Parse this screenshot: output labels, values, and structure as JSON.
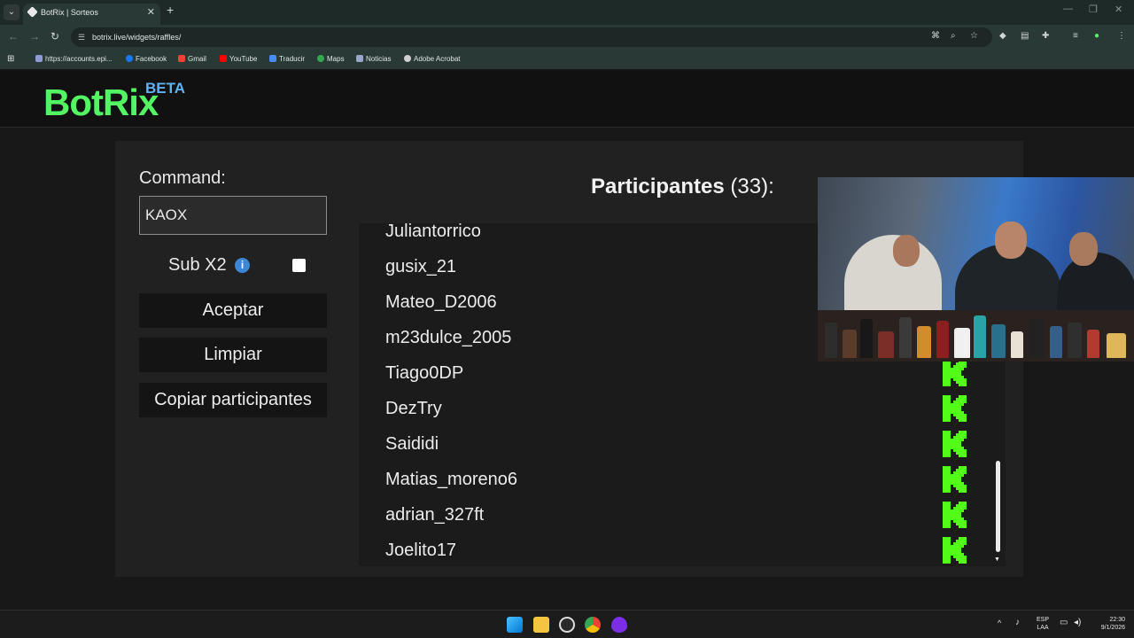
{
  "browser": {
    "tab_title": "BotRix | Sorteos",
    "url": "botrix.live/widgets/raffles/",
    "bookmarks": [
      "https://accounts.epi...",
      "Facebook",
      "Gmail",
      "YouTube",
      "Traducir",
      "Maps",
      "Noticias",
      "Adobe Acrobat"
    ]
  },
  "site": {
    "logo": "BotRix",
    "logo_badge": "BETA"
  },
  "form": {
    "command_label": "Command:",
    "command_value": "KAOX",
    "sub_label": "Sub X2",
    "sub_checked": false,
    "accept_label": "Aceptar",
    "clear_label": "Limpiar",
    "copy_label": "Copiar participantes"
  },
  "participants": {
    "title": "Participantes",
    "count": "(33):",
    "names": [
      "Juliantorrico",
      "gusix_21",
      "Mateo_D2006",
      "m23dulce_2005",
      "Tiago0DP",
      "DezTry",
      "Saididi",
      "Matias_moreno6",
      "adrian_327ft",
      "Joelito17"
    ],
    "platform_icon": "kick-icon",
    "platform_color": "#53fc18"
  },
  "taskbar": {
    "lang_top": "ESP",
    "lang_bottom": "LAA",
    "time": "22:30",
    "date": "9/1/2026"
  },
  "colors": {
    "brand_green": "#53f563",
    "beta_blue": "#5fb4f0",
    "kick_green": "#53fc18"
  }
}
